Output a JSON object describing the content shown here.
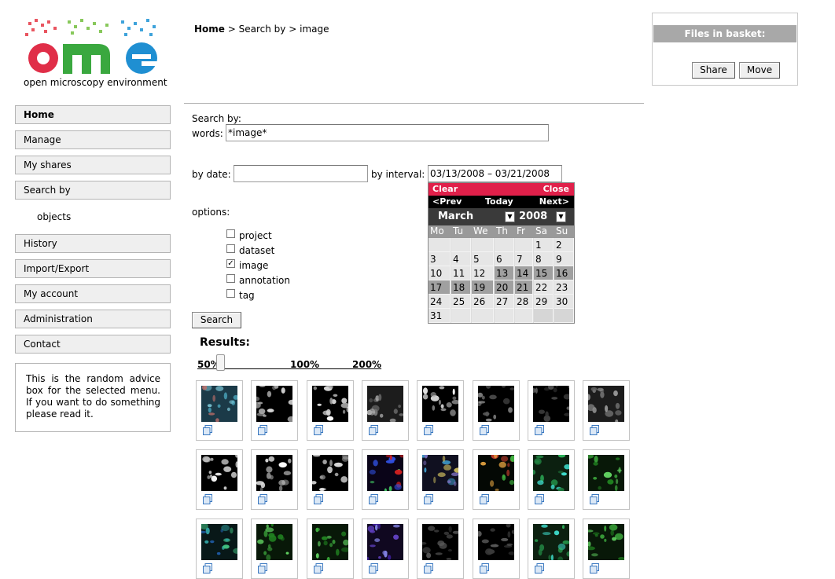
{
  "logo": {
    "caption": "open microscopy environment"
  },
  "breadcrumb": {
    "home": "Home",
    "separator": " > ",
    "level1": "Search by",
    "level2": "image"
  },
  "menu": {
    "items": [
      "Home",
      "Manage",
      "My shares",
      "Search by",
      "History",
      "Import/Export",
      "My account",
      "Administration",
      "Contact"
    ],
    "submenu": "objects",
    "active": "Home"
  },
  "advice": {
    "text": "This is the random advice box for the selected menu. If you want to do something please read it."
  },
  "basket": {
    "title": "Files in basket:",
    "share_label": "Share",
    "move_label": "Move"
  },
  "search": {
    "search_by_label": "Search by:",
    "words_label": "words:",
    "words_value": "*image*",
    "date_label": "by date:",
    "date_value": "",
    "interval_label": "by interval:",
    "interval_value": "03/13/2008 – 03/21/2008",
    "options_label": "options:",
    "options": [
      {
        "label": "project",
        "checked": false
      },
      {
        "label": "dataset",
        "checked": false
      },
      {
        "label": "image",
        "checked": true
      },
      {
        "label": "annotation",
        "checked": false
      },
      {
        "label": "tag",
        "checked": false
      }
    ],
    "button_label": "Search"
  },
  "calendar": {
    "clear": "Clear",
    "close": "Close",
    "prev": "<Prev",
    "today": "Today",
    "next": "Next>",
    "month": "March",
    "year": "2008",
    "weekdays": [
      "Mo",
      "Tu",
      "We",
      "Th",
      "Fr",
      "Sa",
      "Su"
    ],
    "weeks": [
      [
        "",
        "",
        "",
        "",
        "",
        "1",
        "2"
      ],
      [
        "3",
        "4",
        "5",
        "6",
        "7",
        "8",
        "9"
      ],
      [
        "10",
        "11",
        "12",
        "13",
        "14",
        "15",
        "16"
      ],
      [
        "17",
        "18",
        "19",
        "20",
        "21",
        "22",
        "23"
      ],
      [
        "24",
        "25",
        "26",
        "27",
        "28",
        "29",
        "30"
      ],
      [
        "31",
        "",
        "",
        "",
        "",
        "",
        ""
      ]
    ],
    "selected_days": [
      "13",
      "14",
      "15",
      "16",
      "17",
      "18",
      "19",
      "20",
      "21"
    ]
  },
  "results": {
    "title": "Results:",
    "zoom_labels": [
      "50%",
      "100%",
      "200%"
    ],
    "zoom_value_percent": 68,
    "thumbnails": [
      {
        "style": "blue-cells"
      },
      {
        "style": "gray-nuclei"
      },
      {
        "style": "gray-nuclei"
      },
      {
        "style": "gray-cells"
      },
      {
        "style": "gray-nuclei"
      },
      {
        "style": "gray-sparse"
      },
      {
        "style": "dark"
      },
      {
        "style": "gray-cells"
      },
      {
        "style": "gray-nuclei"
      },
      {
        "style": "gray-nuclei"
      },
      {
        "style": "gray-nuclei"
      },
      {
        "style": "multicolor-neuron"
      },
      {
        "style": "multicolor-cell"
      },
      {
        "style": "multicolor-red"
      },
      {
        "style": "green-cyan"
      },
      {
        "style": "green-cells"
      },
      {
        "style": "teal-cells"
      },
      {
        "style": "green-cells"
      },
      {
        "style": "green-cells"
      },
      {
        "style": "purple-cells"
      },
      {
        "style": "dark"
      },
      {
        "style": "dark"
      },
      {
        "style": "green-cyan"
      },
      {
        "style": "green-cells"
      }
    ]
  },
  "colors": {
    "calendar_clear_bar": "#e0204a",
    "calendar_selected": "#a0a0a0",
    "menu_bg": "#efefef",
    "basket_title_bg": "#a8a8a8"
  }
}
